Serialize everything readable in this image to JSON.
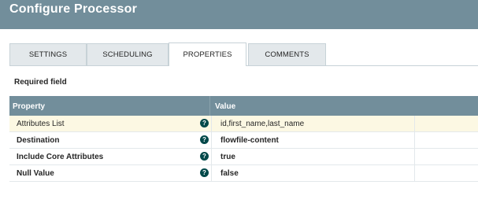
{
  "header": {
    "title": "Configure Processor"
  },
  "tabs": [
    {
      "label": "SETTINGS"
    },
    {
      "label": "SCHEDULING"
    },
    {
      "label": "PROPERTIES",
      "active": true
    },
    {
      "label": "COMMENTS"
    }
  ],
  "required_label": "Required field",
  "table": {
    "headers": {
      "property": "Property",
      "value": "Value"
    },
    "rows": [
      {
        "name": "Attributes List",
        "value": "id,first_name,last_name",
        "required": false,
        "selected": true
      },
      {
        "name": "Destination",
        "value": "flowfile-content",
        "required": true
      },
      {
        "name": "Include Core Attributes",
        "value": "true",
        "required": true
      },
      {
        "name": "Null Value",
        "value": "false",
        "required": true
      }
    ],
    "help_icon_glyph": "?"
  },
  "colors": {
    "header_bg": "#728e9b",
    "selected_row_bg": "#fcf8e3",
    "help_icon_bg": "#004849"
  }
}
